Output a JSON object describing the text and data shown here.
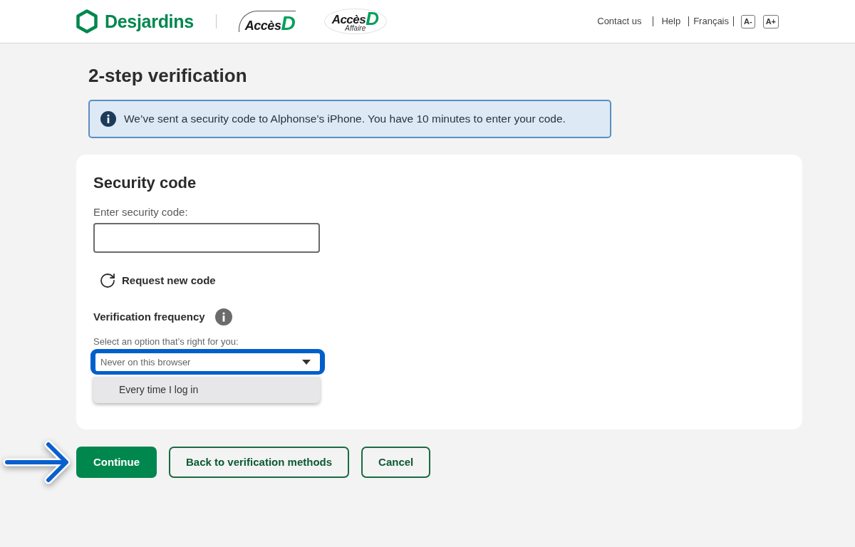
{
  "header": {
    "brand": "Desjardins",
    "product_logos": [
      {
        "name": "Accès",
        "mark": "D"
      },
      {
        "name": "Accès",
        "mark": "D",
        "subtitle": "Affaire"
      }
    ],
    "links": [
      {
        "label": "Contact us"
      },
      {
        "label": "Help"
      },
      {
        "label": "Français"
      }
    ],
    "text_size_buttons": [
      {
        "label": "A-"
      },
      {
        "label": "A+"
      }
    ]
  },
  "page_title": "2-step verification",
  "alert": {
    "kind": "info",
    "text": "We’ve sent a security code to Alphonse’s iPhone. You have 10 minutes to enter your code."
  },
  "card": {
    "title": "Security code",
    "code_field": {
      "label": "Enter security code:"
    },
    "request_code": {
      "label": "Request new code"
    },
    "frequency": {
      "title": "Verification frequency",
      "hint": "Select an option that’s right for you:",
      "select": {
        "value": "Never on this browser",
        "focused": true,
        "expanded": true,
        "options": [
          {
            "label": "Every time I log in",
            "highlighted": true
          }
        ]
      }
    }
  },
  "actions": [
    {
      "label": "Continue",
      "kind": "primary"
    },
    {
      "label": "Back to verification methods",
      "kind": "secondary"
    },
    {
      "label": "Cancel",
      "kind": "secondary"
    }
  ]
}
